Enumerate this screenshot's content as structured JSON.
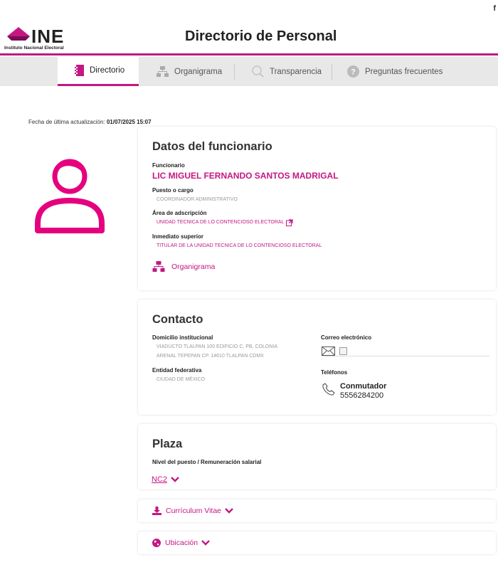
{
  "topbar": {
    "facebook_glyph": "f"
  },
  "header": {
    "logo_text": "INE",
    "logo_subtitle": "Instituto Nacional Electoral",
    "title": "Directorio de Personal",
    "accent_color": "#c41782"
  },
  "nav": {
    "tabs": [
      {
        "label": "Directorio",
        "icon": "directory-book-icon",
        "active": true
      },
      {
        "label": "Organigrama",
        "icon": "org-chart-icon",
        "active": false
      },
      {
        "label": "Transparencia",
        "icon": "search-icon",
        "active": false
      },
      {
        "label": "Preguntas frecuentes",
        "icon": "question-icon",
        "active": false
      }
    ]
  },
  "update": {
    "label": "Fecha de última actualización:",
    "value": "01/07/2025 15:07"
  },
  "datos": {
    "title": "Datos del funcionario",
    "funcionario_label": "Funcionario",
    "funcionario_value": "LIC MIGUEL FERNANDO SANTOS MADRIGAL",
    "puesto_label": "Puesto o cargo",
    "puesto_value": "COORDINADOR ADMINISTRATIVO",
    "area_label": "Área de adscripción",
    "area_value": "UNIDAD TECNICA DE LO CONTENCIOSO ELECTORAL",
    "superior_label": "Inmediato superior",
    "superior_value": "TITULAR DE LA UNIDAD TECNICA DE LO CONTENCIOSO ELECTORAL",
    "organigrama_link": "Organigrama"
  },
  "contacto": {
    "title": "Contacto",
    "domicilio_label": "Domicilio institucional",
    "domicilio_line1": "VIADUCTO TLALPAN 100 EDIFICIO C, PB, COLONIA",
    "domicilio_line2": "ARENAL TEPEPAN CP. 14610 TLALPAN CDMX",
    "entidad_label": "Entidad federativa",
    "entidad_value": "CIUDAD DE MÉXICO",
    "correo_label": "Correo electrónico",
    "telefonos_label": "Teléfonos",
    "conmutador_label": "Conmutador",
    "conmutador_value": "5556284200"
  },
  "plaza": {
    "title": "Plaza",
    "nivel_label": "Nivel del puesto / Remuneración salarial",
    "nivel_value": "NC2"
  },
  "curriculum": {
    "label": "Currículum Vitae"
  },
  "ubicacion": {
    "label": "Ubicación"
  }
}
